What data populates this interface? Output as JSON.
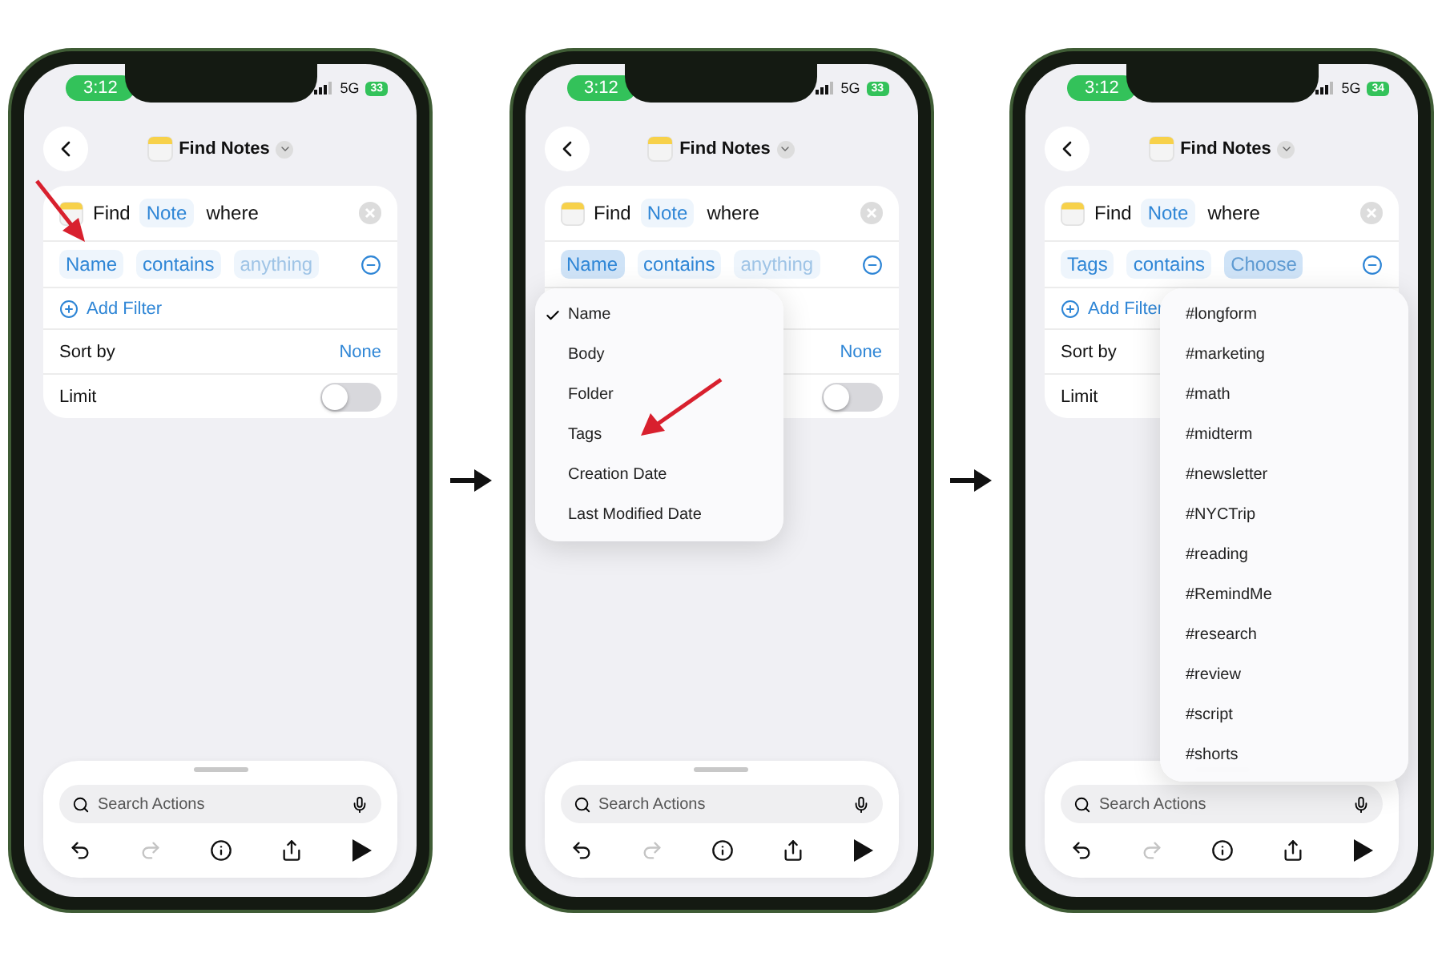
{
  "screens": [
    {
      "status": {
        "time": "3:12",
        "network": "5G",
        "battery": "33"
      },
      "nav": {
        "title": "Find Notes"
      },
      "query": {
        "verb": "Find",
        "entity": "Note",
        "connector": "where"
      },
      "filter": {
        "field": {
          "label": "Name",
          "selected": false
        },
        "operator": {
          "label": "contains",
          "selected": false
        },
        "value": {
          "placeholder": "anything",
          "selected": false
        }
      },
      "add_filter": "Add Filter",
      "sort": {
        "label": "Sort by",
        "value": "None"
      },
      "limit": {
        "label": "Limit",
        "on": false
      },
      "pointer_arrow": true,
      "search": {
        "placeholder": "Search Actions"
      }
    },
    {
      "status": {
        "time": "3:12",
        "network": "5G",
        "battery": "33"
      },
      "nav": {
        "title": "Find Notes"
      },
      "query": {
        "verb": "Find",
        "entity": "Note",
        "connector": "where"
      },
      "filter": {
        "field": {
          "label": "Name",
          "selected": true
        },
        "operator": {
          "label": "contains",
          "selected": false
        },
        "value": {
          "placeholder": "anything",
          "selected": false
        }
      },
      "sort": {
        "value": "None"
      },
      "limit": {
        "on": false
      },
      "pointer_arrow": true,
      "menu": {
        "kind": "options",
        "items": [
          {
            "label": "Name",
            "selected": true
          },
          {
            "label": "Body",
            "selected": false
          },
          {
            "label": "Folder",
            "selected": false
          },
          {
            "label": "Tags",
            "selected": false
          },
          {
            "label": "Creation Date",
            "selected": false
          },
          {
            "label": "Last Modified Date",
            "selected": false
          }
        ]
      },
      "search": {
        "placeholder": "Search Actions"
      }
    },
    {
      "status": {
        "time": "3:12",
        "network": "5G",
        "battery": "34"
      },
      "nav": {
        "title": "Find Notes"
      },
      "query": {
        "verb": "Find",
        "entity": "Note",
        "connector": "where"
      },
      "filter": {
        "field": {
          "label": "Tags",
          "selected": false
        },
        "operator": {
          "label": "contains",
          "selected": false
        },
        "value": {
          "placeholder": "Choose",
          "selected": true
        }
      },
      "add_filter": "Add Filter",
      "sort": {
        "label": "Sort by"
      },
      "limit": {
        "label": "Limit"
      },
      "menu": {
        "kind": "tags",
        "items": [
          {
            "label": "#longform",
            "selected": false
          },
          {
            "label": "#marketing",
            "selected": false
          },
          {
            "label": "#math",
            "selected": false
          },
          {
            "label": "#midterm",
            "selected": false
          },
          {
            "label": "#newsletter",
            "selected": false
          },
          {
            "label": "#NYCTrip",
            "selected": false
          },
          {
            "label": "#reading",
            "selected": false
          },
          {
            "label": "#RemindMe",
            "selected": false
          },
          {
            "label": "#research",
            "selected": false
          },
          {
            "label": "#review",
            "selected": false
          },
          {
            "label": "#script",
            "selected": false
          },
          {
            "label": "#shorts",
            "selected": false
          }
        ]
      },
      "search": {
        "placeholder": "Search Actions"
      }
    }
  ]
}
